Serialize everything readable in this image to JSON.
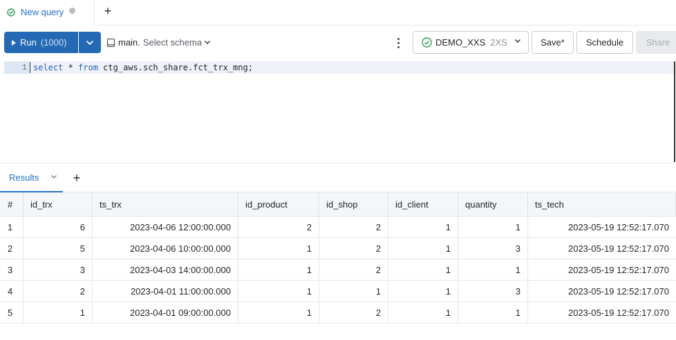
{
  "tabs": [
    {
      "label": "New query",
      "unsaved": true
    }
  ],
  "toolbar": {
    "run_label": "Run",
    "run_limit": "(1000)",
    "catalog": "main",
    "separator": ".",
    "schema_placeholder": "Select schema",
    "warehouse_name": "DEMO_XXS",
    "warehouse_size": "2XS",
    "save_label": "Save*",
    "schedule_label": "Schedule",
    "share_label": "Share"
  },
  "editor": {
    "line_number": "1",
    "query": {
      "kw_select": "select",
      "star": " * ",
      "kw_from": "from",
      "rest": " ctg_aws.sch_share.fct_trx_mng;"
    }
  },
  "results": {
    "tab_label": "Results",
    "columns": [
      "#",
      "id_trx",
      "ts_trx",
      "id_product",
      "id_shop",
      "id_client",
      "quantity",
      "ts_tech"
    ],
    "rows": [
      [
        "1",
        "6",
        "2023-04-06 12:00:00.000",
        "2",
        "2",
        "1",
        "1",
        "2023-05-19 12:52:17.070"
      ],
      [
        "2",
        "5",
        "2023-04-06 10:00:00.000",
        "1",
        "2",
        "1",
        "3",
        "2023-05-19 12:52:17.070"
      ],
      [
        "3",
        "3",
        "2023-04-03 14:00:00.000",
        "1",
        "2",
        "1",
        "1",
        "2023-05-19 12:52:17.070"
      ],
      [
        "4",
        "2",
        "2023-04-01 11:00:00.000",
        "1",
        "1",
        "1",
        "3",
        "2023-05-19 12:52:17.070"
      ],
      [
        "5",
        "1",
        "2023-04-01 09:00:00.000",
        "1",
        "2",
        "1",
        "1",
        "2023-05-19 12:52:17.070"
      ]
    ]
  },
  "colors": {
    "accent": "#2472c8",
    "run_button": "#2469b3",
    "status_ok": "#2e9e4f"
  }
}
